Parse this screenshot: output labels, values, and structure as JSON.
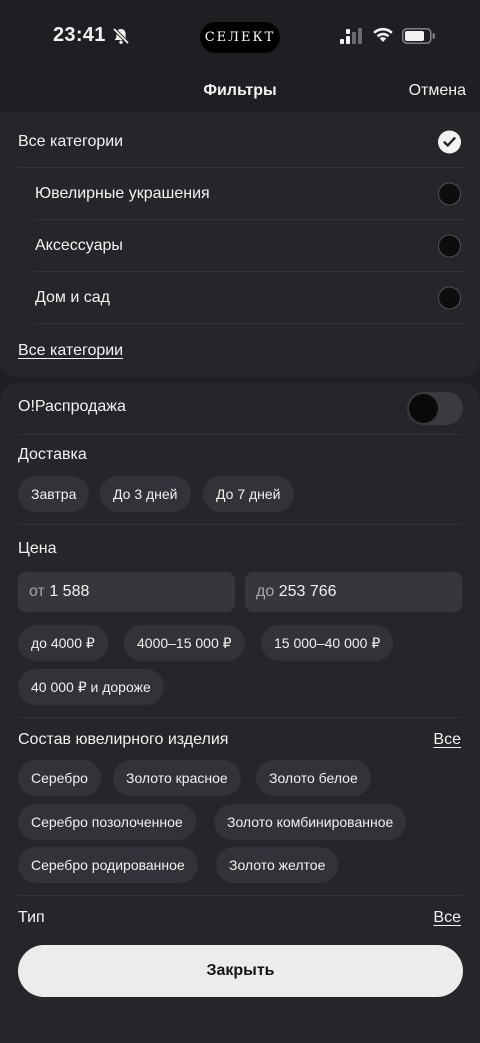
{
  "status_bar": {
    "time": "23:41",
    "island_text": "СЕЛЕКТ"
  },
  "header": {
    "title": "Фильтры",
    "cancel": "Отмена"
  },
  "categories": {
    "items": [
      {
        "label": "Все категории",
        "selected": true
      },
      {
        "label": "Ювелирные украшения",
        "selected": false
      },
      {
        "label": "Аксессуары",
        "selected": false
      },
      {
        "label": "Дом и сад",
        "selected": false
      }
    ],
    "all_link": "Все категории"
  },
  "sale": {
    "label": "О!Распродажа",
    "enabled": false
  },
  "delivery": {
    "title": "Доставка",
    "options": [
      "Завтра",
      "До 3 дней",
      "До 7 дней"
    ]
  },
  "price": {
    "title": "Цена",
    "from_prefix": "от",
    "from_value": "1 588",
    "to_prefix": "до",
    "to_value": "253 766",
    "ranges": [
      "до 4000 ₽",
      "4000–15 000 ₽",
      "15 000–40 000 ₽",
      "40 000 ₽ и дороже"
    ]
  },
  "composition": {
    "title": "Состав ювелирного изделия",
    "all_label": "Все",
    "options": [
      "Серебро",
      "Золото красное",
      "Золото белое",
      "Серебро позолоченное",
      "Золото комбинированное",
      "Серебро родированное",
      "Золото желтое"
    ]
  },
  "type": {
    "title": "Тип",
    "all_label": "Все"
  },
  "close_button": "Закрыть"
}
